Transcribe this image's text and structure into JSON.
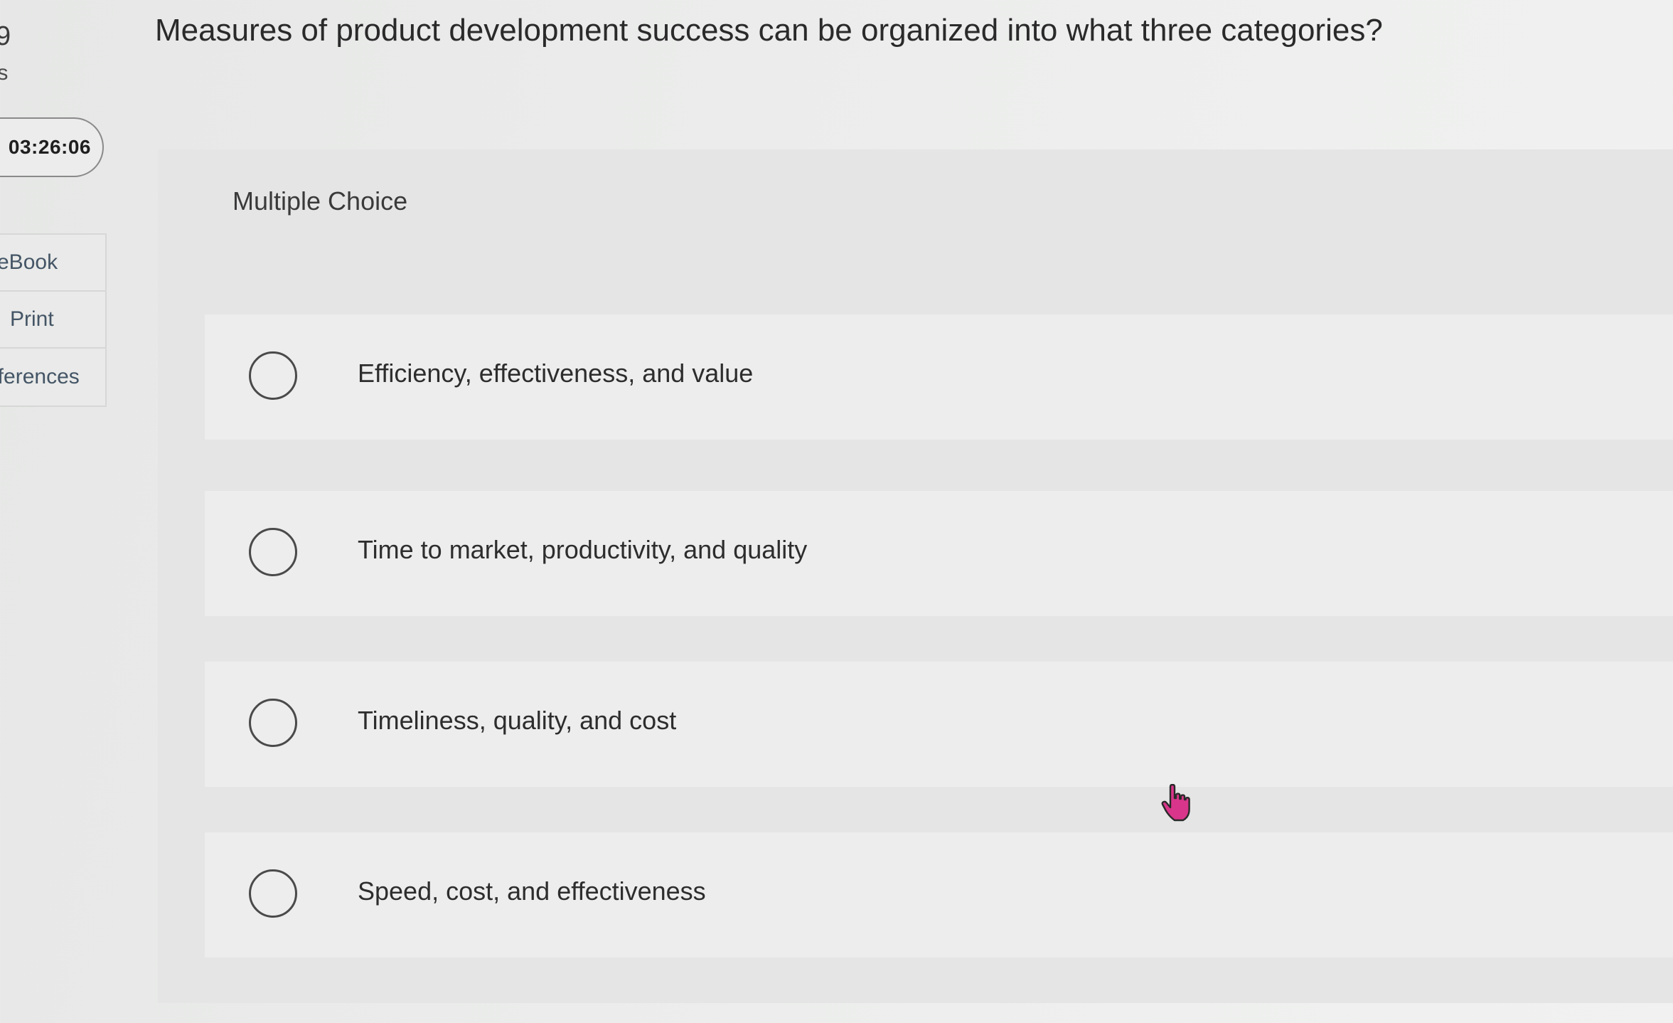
{
  "sidebar": {
    "question_number": "9",
    "points_label": "ts",
    "timer": "03:26:06",
    "menu": [
      {
        "label": "eBook"
      },
      {
        "label": "Print"
      },
      {
        "label": "eferences"
      }
    ]
  },
  "question": {
    "text": "Measures of product development success can be organized into what three categories?",
    "type_label": "Multiple Choice",
    "options": [
      {
        "label": "Efficiency, effectiveness, and value",
        "selected": false
      },
      {
        "label": "Time to market, productivity, and quality",
        "selected": false
      },
      {
        "label": "Timeliness, quality, and cost",
        "selected": false
      },
      {
        "label": "Speed, cost, and effectiveness",
        "selected": false
      }
    ]
  },
  "colors": {
    "cursor": "#d9358a",
    "radio_border": "#4a4a4a",
    "menu_text": "#445566"
  },
  "cursor_icon": "hand-pointer-icon"
}
